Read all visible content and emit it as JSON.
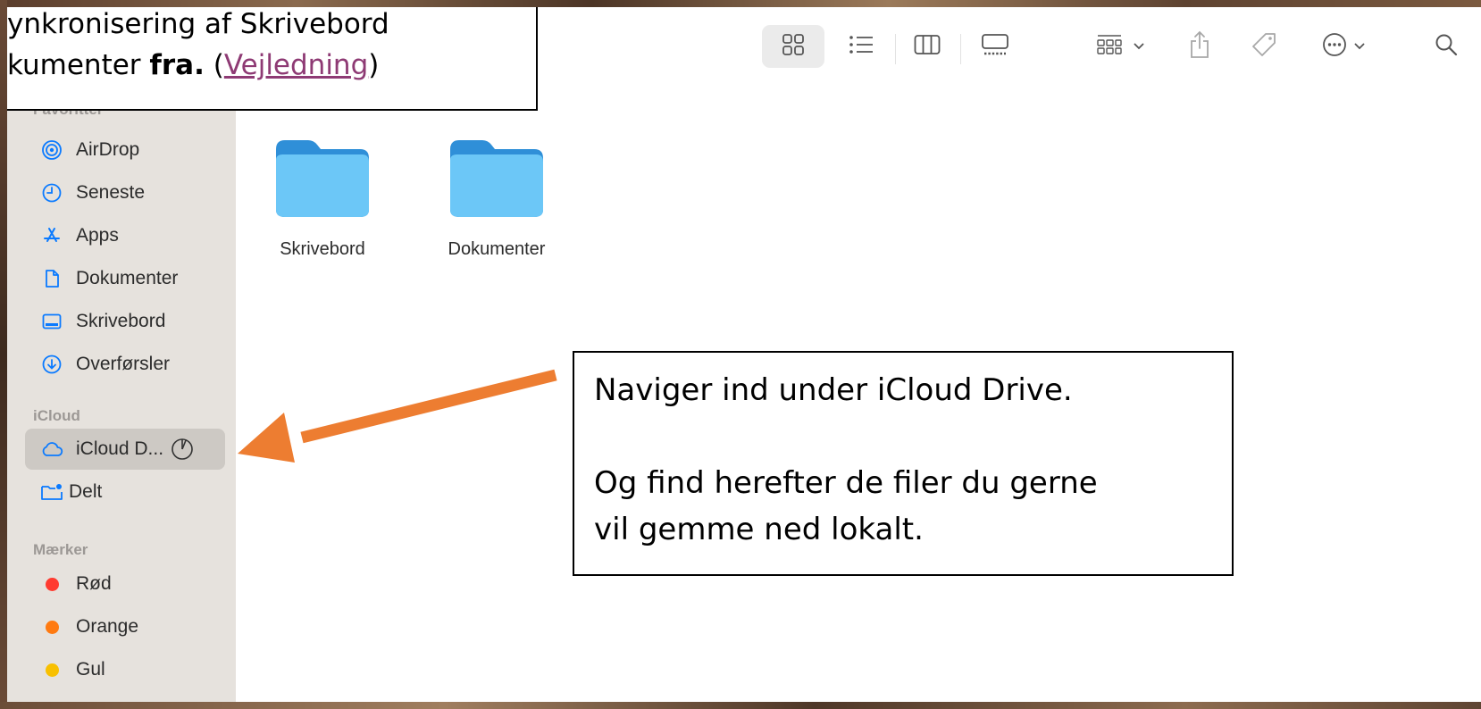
{
  "banner": {
    "line1": "ynkronisering af Skrivebord",
    "line2_prefix": "kumenter ",
    "line2_bold": "fra.",
    "line2_open": " (",
    "line2_link": "Vejledning",
    "line2_close": ")"
  },
  "sidebar": {
    "favorites_label": "Favoritter",
    "favorites": [
      {
        "label": "AirDrop",
        "icon": "airdrop-icon"
      },
      {
        "label": "Seneste",
        "icon": "clock-icon"
      },
      {
        "label": "Apps",
        "icon": "apps-icon"
      },
      {
        "label": "Dokumenter",
        "icon": "document-icon"
      },
      {
        "label": "Skrivebord",
        "icon": "desktop-icon"
      },
      {
        "label": "Overførsler",
        "icon": "download-icon"
      }
    ],
    "icloud_label": "iCloud",
    "icloud": [
      {
        "label": "iCloud D...",
        "icon": "cloud-icon",
        "selected": true
      },
      {
        "label": "Delt",
        "icon": "shared-folder-icon"
      }
    ],
    "tags_label": "Mærker",
    "tags": [
      {
        "label": "Rød",
        "color": "#ff3b30"
      },
      {
        "label": "Orange",
        "color": "#ff9500"
      },
      {
        "label": "Gul",
        "color": "#ffcc00"
      }
    ]
  },
  "toolbar": {
    "buttons": [
      "icon-view-icon",
      "list-view-icon",
      "column-view-icon",
      "gallery-view-icon",
      "group-icon",
      "share-icon",
      "tag-icon",
      "more-icon",
      "search-icon"
    ]
  },
  "content": {
    "folders": [
      {
        "label": "Skrivebord",
        "color": "#5ab8ef"
      },
      {
        "label": "Dokumenter",
        "color": "#5ab8ef"
      }
    ]
  },
  "callout": {
    "line1": "Naviger ind under iCloud Drive.",
    "line2": "Og find herefter de filer du gerne",
    "line3": "vil gemme ned lokalt."
  },
  "colors": {
    "arrow": "#ed7d31",
    "accent": "#0a7aff"
  }
}
